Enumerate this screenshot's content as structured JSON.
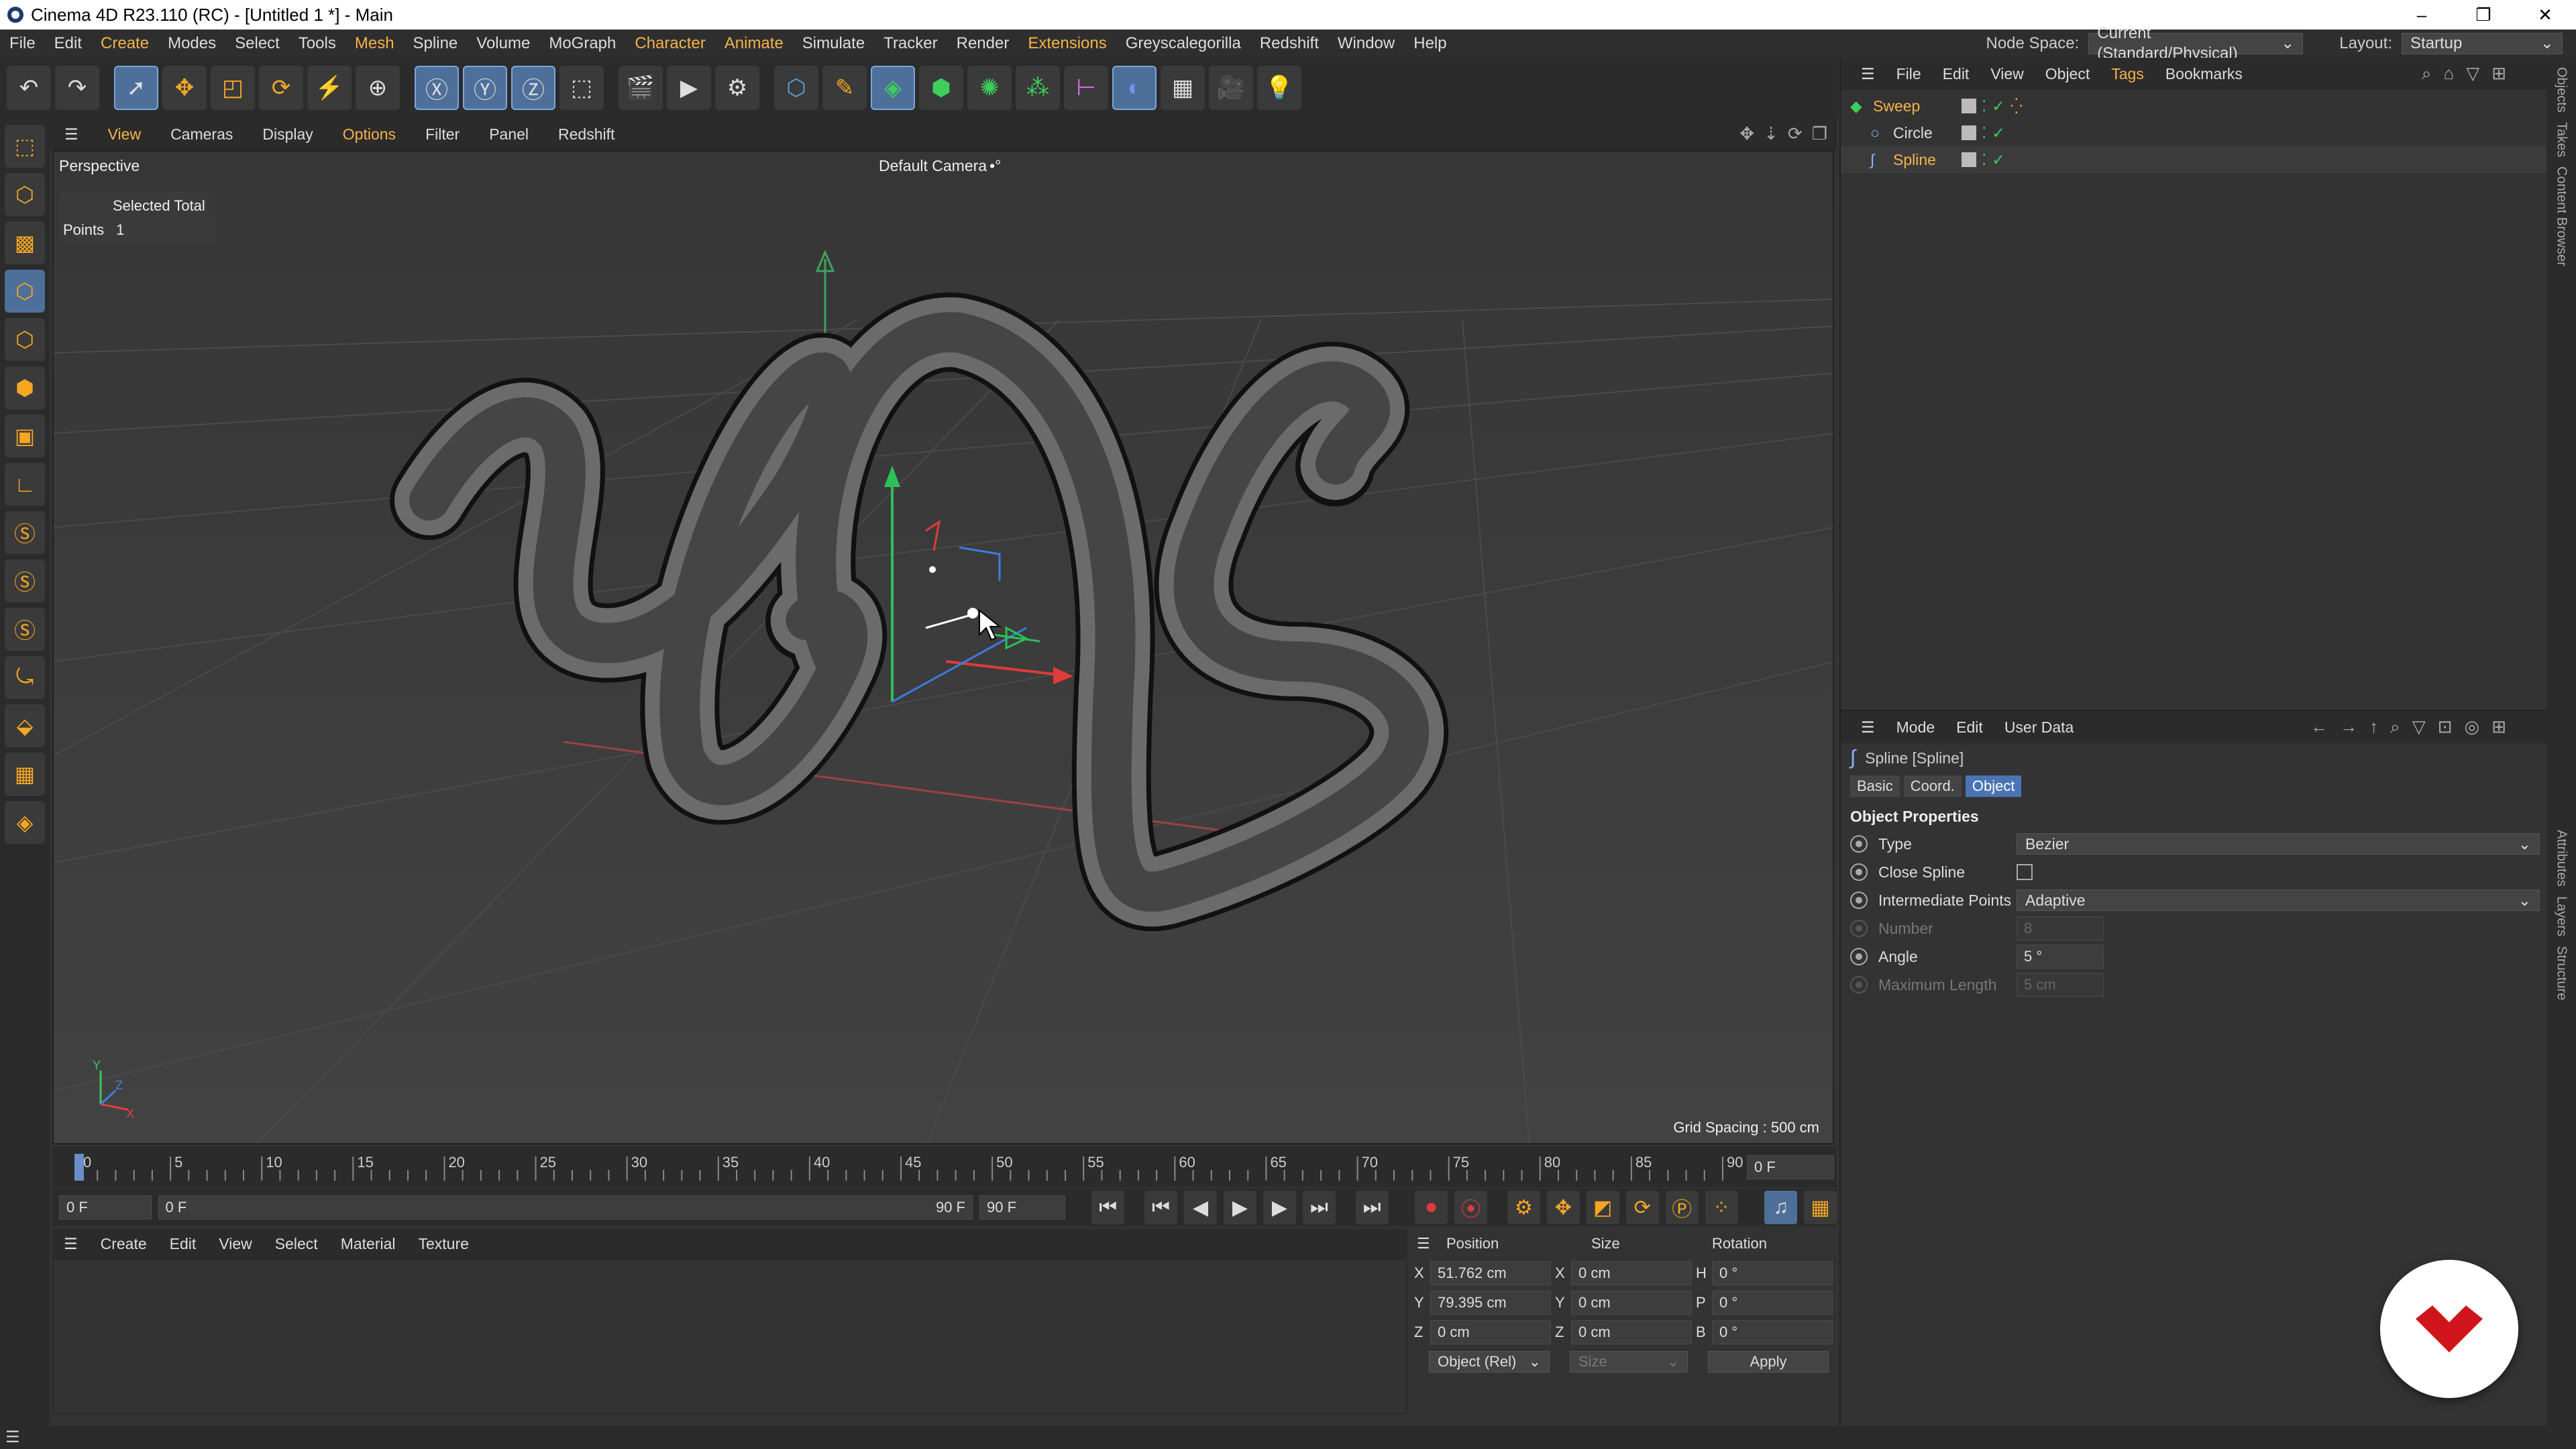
{
  "window": {
    "title": "Cinema 4D R23.110 (RC) - [Untitled 1 *] - Main",
    "minimize": "–",
    "restore": "❐",
    "close": "✕"
  },
  "menu": {
    "items": [
      "File",
      "Edit",
      "Create",
      "Modes",
      "Select",
      "Tools",
      "Mesh",
      "Spline",
      "Volume",
      "MoGraph",
      "Character",
      "Animate",
      "Simulate",
      "Tracker",
      "Render",
      "Extensions",
      "Greyscalegorilla",
      "Redshift",
      "Window",
      "Help"
    ],
    "node_space_label": "Node Space:",
    "node_space_value": "Current (Standard/Physical)",
    "layout_label": "Layout:",
    "layout_value": "Startup"
  },
  "toolbar_icons": [
    "undo-icon",
    "redo-icon",
    "live-selection-icon",
    "move-icon",
    "scale-icon",
    "rotate-icon",
    "recent-tools-icon",
    "world-coordinates-icon",
    "x-axis-lock-icon",
    "y-axis-lock-icon",
    "z-axis-lock-icon",
    "coordinate-system-icon",
    "render-view-icon",
    "render-picture-viewer-icon",
    "render-settings-icon",
    "cube-icon",
    "pen-icon",
    "subdivision-icon",
    "extrude-icon",
    "cloner-icon",
    "array-icon",
    "symmetry-icon",
    "deformer-icon",
    "floor-icon",
    "camera-icon",
    "light-icon"
  ],
  "left_tools": [
    "make-editable-icon",
    "model-mode-icon",
    "texture-mode-icon",
    "points-mode-icon",
    "edges-mode-icon",
    "polygons-mode-icon",
    "uv-mode-icon",
    "axis-mode-icon",
    "snap-icon",
    "soft-selection-icon",
    "symmetry-s-icon",
    "magnet-icon",
    "workplane-icon",
    "grid-snap-icon",
    "quantize-icon"
  ],
  "viewport": {
    "menu": [
      "View",
      "Cameras",
      "Display",
      "Options",
      "Filter",
      "Panel",
      "Redshift"
    ],
    "name": "Perspective",
    "camera": "Default Camera",
    "camera_mark": "•°",
    "hud_header": "Selected Total",
    "hud_points_label": "Points",
    "hud_points_value": "1",
    "grid_spacing": "Grid Spacing : 500 cm",
    "axis_x": "X",
    "axis_y": "Y",
    "axis_z": "Z"
  },
  "timeline": {
    "ticks": [
      "0",
      "5",
      "10",
      "15",
      "20",
      "25",
      "30",
      "35",
      "40",
      "45",
      "50",
      "55",
      "60",
      "65",
      "70",
      "75",
      "80",
      "85",
      "90"
    ],
    "current_frame": "0 F",
    "start_field": "0 F",
    "range_start": "0 F",
    "range_end": "90 F",
    "end_field": "90 F",
    "position": 0
  },
  "materials_menu": [
    "Create",
    "Edit",
    "View",
    "Select",
    "Material",
    "Texture"
  ],
  "coordinates": {
    "headers": [
      "Position",
      "Size",
      "Rotation"
    ],
    "rows": [
      {
        "axis": "X",
        "pos": "51.762 cm",
        "saxis": "X",
        "size": "0 cm",
        "raxis": "H",
        "rot": "0 °"
      },
      {
        "axis": "Y",
        "pos": "79.395 cm",
        "saxis": "Y",
        "size": "0 cm",
        "raxis": "P",
        "rot": "0 °"
      },
      {
        "axis": "Z",
        "pos": "0 cm",
        "saxis": "Z",
        "size": "0 cm",
        "raxis": "B",
        "rot": "0 °"
      }
    ],
    "mode": "Object (Rel)",
    "size_mode": "Size",
    "apply": "Apply"
  },
  "objects": {
    "menu": [
      "File",
      "Edit",
      "View",
      "Object",
      "Tags",
      "Bookmarks"
    ],
    "items": [
      {
        "name": "Sweep",
        "color": "#f5b34a",
        "indent": 0
      },
      {
        "name": "Circle",
        "color": "#ddd",
        "indent": 1
      },
      {
        "name": "Spline",
        "color": "#f5b34a",
        "indent": 1
      }
    ]
  },
  "attributes": {
    "menu": [
      "Mode",
      "Edit",
      "User Data"
    ],
    "object_title": "Spline [Spline]",
    "tabs": [
      "Basic",
      "Coord.",
      "Object"
    ],
    "section": "Object Properties",
    "props": {
      "type_label": "Type",
      "type_value": "Bezier",
      "close_label": "Close Spline",
      "inter_label": "Intermediate Points",
      "inter_value": "Adaptive",
      "number_label": "Number",
      "number_value": "8",
      "angle_label": "Angle",
      "angle_value": "5 °",
      "maxlen_label": "Maximum Length",
      "maxlen_value": "5 cm"
    }
  },
  "side_tabs": [
    "Objects",
    "Takes",
    "Content Browser",
    "Attributes",
    "Layers",
    "Structure"
  ],
  "colors": {
    "accent": "#f5b34a",
    "selection": "#4a74b3",
    "x_axis": "#e04040",
    "y_axis": "#40c060",
    "z_axis": "#4080e0",
    "logo": "#d0141c"
  }
}
